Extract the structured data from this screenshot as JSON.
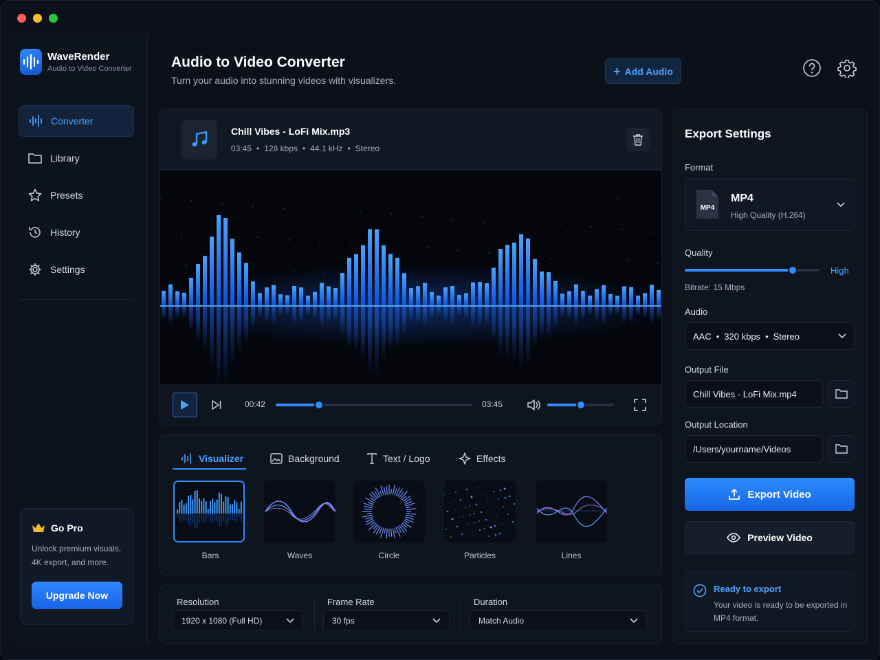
{
  "app": {
    "name": "WaveRender",
    "subtitle": "Audio to Video Converter"
  },
  "sidebar": {
    "items": [
      {
        "label": "Converter",
        "icon": "waveform-icon",
        "active": true
      },
      {
        "label": "Library",
        "icon": "folder-icon"
      },
      {
        "label": "Presets",
        "icon": "star-icon"
      },
      {
        "label": "History",
        "icon": "history-icon"
      },
      {
        "label": "Settings",
        "icon": "gear-icon"
      }
    ],
    "pro": {
      "title": "Go Pro",
      "text": "Unlock premium visuals, 4K export, and more.",
      "button": "Upgrade Now"
    }
  },
  "header": {
    "title": "Audio to Video Converter",
    "subtitle": "Turn your audio into stunning videos with visualizers.",
    "add_audio": "Add Audio"
  },
  "file": {
    "name": "Chill Vibes - LoFi Mix.mp3",
    "duration": "03:45",
    "bitrate": "128 kbps",
    "sample_rate": "44.1 kHz",
    "channels": "Stereo"
  },
  "player": {
    "current_time": "00:42",
    "total_time": "03:45",
    "progress": 0.22,
    "volume": 0.5
  },
  "tabs": [
    {
      "label": "Visualizer",
      "icon": "waveform-icon",
      "active": true
    },
    {
      "label": "Background",
      "icon": "image-icon"
    },
    {
      "label": "Text / Logo",
      "icon": "text-icon"
    },
    {
      "label": "Effects",
      "icon": "sparkle-icon"
    }
  ],
  "visualizers": [
    {
      "label": "Bars",
      "selected": true
    },
    {
      "label": "Waves"
    },
    {
      "label": "Circle"
    },
    {
      "label": "Particles"
    },
    {
      "label": "Lines"
    }
  ],
  "video_settings": {
    "resolution": {
      "label": "Resolution",
      "value": "1920 x 1080 (Full HD)"
    },
    "frame_rate": {
      "label": "Frame Rate",
      "value": "30 fps"
    },
    "duration": {
      "label": "Duration",
      "value": "Match Audio"
    }
  },
  "export": {
    "title": "Export Settings",
    "format_label": "Format",
    "format_name": "MP4",
    "format_sub": "High Quality (H.264)",
    "format_badge": "MP4",
    "quality_label": "Quality",
    "quality_level": 0.8,
    "quality_value": "High",
    "bitrate": "Bitrate: 15 Mbps",
    "audio_label": "Audio",
    "audio_codec": "AAC",
    "audio_bitrate": "320 kbps",
    "audio_channels": "Stereo",
    "output_file_label": "Output File",
    "output_file": "Chill Vibes - LoFi Mix.mp4",
    "output_location_label": "Output Location",
    "output_location": "/Users/yourname/Videos",
    "export_button": "Export Video",
    "preview_button": "Preview Video",
    "status_title": "Ready to export",
    "status_text": "Your video is ready to be exported in MP4 format."
  },
  "colors": {
    "accent": "#2d8cff",
    "background": "#0b1019",
    "panel": "#0f151f"
  }
}
